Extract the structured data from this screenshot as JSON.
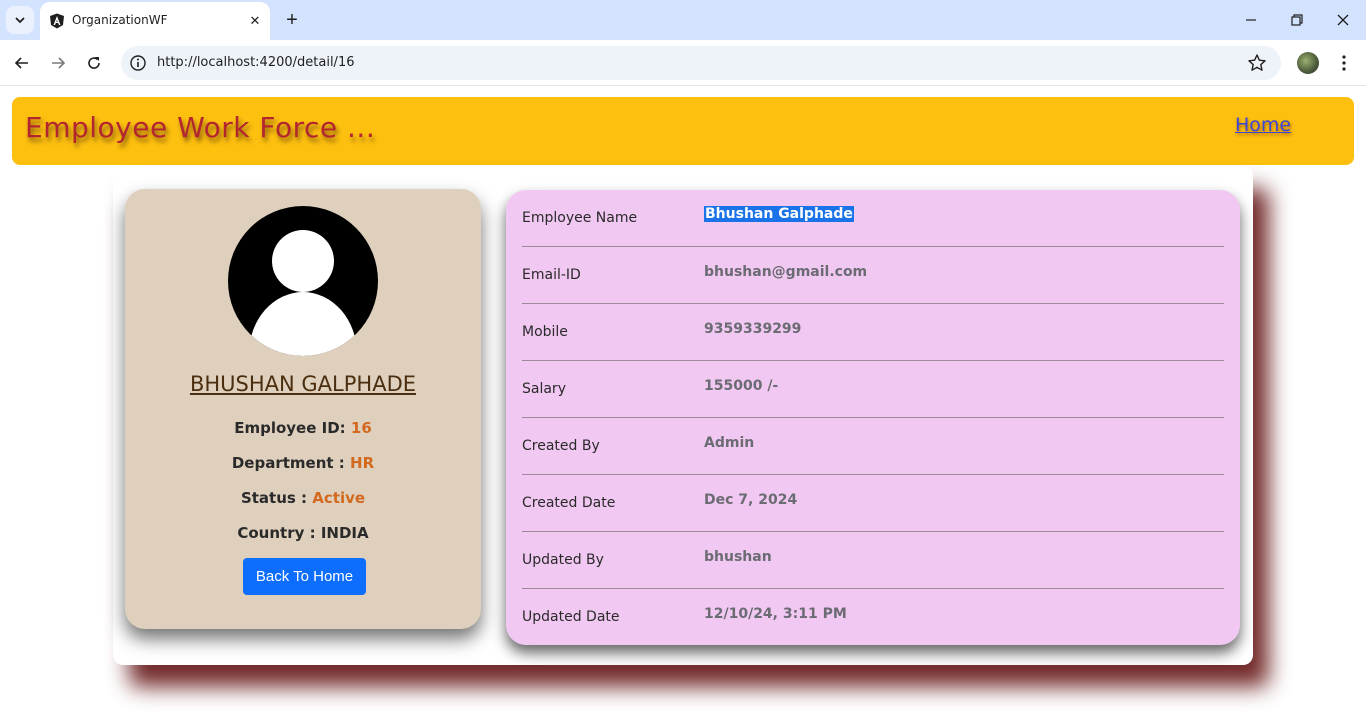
{
  "browser": {
    "tab_title": "OrganizationWF",
    "url": "http://localhost:4200/detail/16",
    "new_tab_symbol": "+",
    "close_symbol": "✕"
  },
  "header": {
    "brand": "Employee Work Force ...",
    "home_link": "Home",
    "brand_color": "#b3262f",
    "background": "#fdc00f"
  },
  "profile": {
    "name": "BHUSHAN GALPHADE",
    "employee_id_label": "Employee ID:",
    "employee_id": "16",
    "department_label": "Department :",
    "department": "HR",
    "status_label": "Status :",
    "status": "Active",
    "country_label": "Country :",
    "country": "INDIA",
    "back_button": "Back To Home",
    "accent_color": "#d2691e"
  },
  "details": {
    "rows": [
      {
        "label": "Employee Name",
        "value": "Bhushan Galphade"
      },
      {
        "label": "Email-ID",
        "value": "bhushan@gmail.com"
      },
      {
        "label": "Mobile",
        "value": "9359339299"
      },
      {
        "label": "Salary",
        "value": "155000 /-"
      },
      {
        "label": "Created By",
        "value": "Admin"
      },
      {
        "label": "Created Date",
        "value": "Dec 7, 2024"
      },
      {
        "label": "Updated By",
        "value": "bhushan"
      },
      {
        "label": "Updated Date",
        "value": "12/10/24, 3:11 PM"
      }
    ]
  },
  "icons": {
    "tab_search": "chevron-down-icon",
    "favicon": "angular-icon",
    "back": "arrow-left-icon",
    "forward": "arrow-right-icon",
    "reload": "reload-icon",
    "site_info": "info-icon",
    "bookmark": "star-icon",
    "menu": "kebab-menu-icon",
    "avatar": "user-avatar-icon"
  }
}
